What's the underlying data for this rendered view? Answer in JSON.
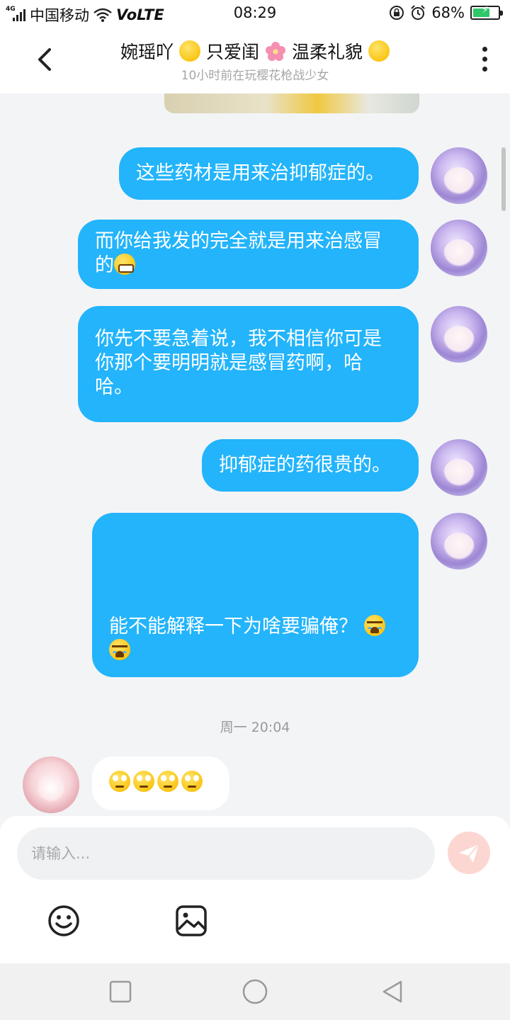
{
  "status": {
    "network_tag": "4G",
    "carrier": "中国移动",
    "volte": "VoLTE",
    "time": "08:29",
    "battery_percent": "68%",
    "battery_level": 0.68
  },
  "header": {
    "title_parts": [
      "婉瑶吖",
      "只爱闺",
      "温柔礼貌"
    ],
    "subtitle": "10小时前在玩樱花枪战少女"
  },
  "messages": [
    {
      "from": "me",
      "text": "这些药材是用来治抑郁症的。"
    },
    {
      "from": "me",
      "text": "而你给我发的完全就是用来治感冒\n的",
      "emoji": "grinning-face"
    },
    {
      "from": "me",
      "text": "你先不要急着说，我不相信你可是\n你那个要明明就是感冒药啊，哈\n哈。"
    },
    {
      "from": "me",
      "text": "抑郁症的药很贵的。"
    },
    {
      "from": "me",
      "text": "能不能解释一下为啥要骗俺？",
      "emoji": "loudly-crying-face"
    }
  ],
  "time_separator": "周一 20:04",
  "incoming": {
    "emoji": "face-with-rolling-eyes",
    "count": 4
  },
  "composer": {
    "placeholder": "请输入..."
  },
  "colors": {
    "bubble_out": "#23b4fb",
    "send_button": "#fcd7d2",
    "background": "#f3f4f6"
  }
}
